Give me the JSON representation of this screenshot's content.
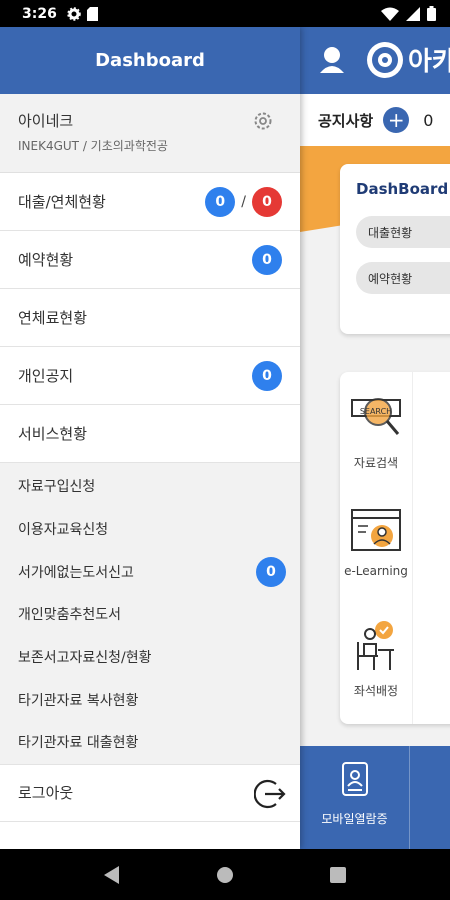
{
  "status_bar": {
    "time": "3:26"
  },
  "app": {
    "logo_text": "아카",
    "notice": {
      "title": "공지사항",
      "plus": "+",
      "count": "0"
    },
    "dashboard_card": {
      "title": "DashBoard",
      "pills": [
        "대출현황",
        "예약현황"
      ]
    },
    "menu": [
      {
        "label": "자료검색",
        "icon": "search-icon"
      },
      {
        "label": "e-Learning",
        "icon": "elearning-icon"
      },
      {
        "label": "좌석배정",
        "icon": "seat-icon"
      }
    ],
    "search_icon_text": "SEARCH",
    "bottom_tab": {
      "label": "모바일열람증",
      "icon": "mobile-card-icon"
    }
  },
  "drawer": {
    "title": "Dashboard",
    "profile": {
      "name": "아이네크",
      "sub": "INEK4GUT / 기초의과학전공"
    },
    "main_items": [
      {
        "label": "대출/연체현황"
      },
      {
        "label": "예약현황"
      },
      {
        "label": "연체료현황"
      },
      {
        "label": "개인공지"
      },
      {
        "label": "서비스현황"
      }
    ],
    "loan_badges": {
      "loan": "0",
      "slash": "/",
      "overdue": "0"
    },
    "reserve_badge": "0",
    "notice_badge": "0",
    "sub_items": [
      {
        "label": "자료구입신청"
      },
      {
        "label": "이용자교육신청"
      },
      {
        "label": "서가에없는도서신고"
      },
      {
        "label": "개인맞춤추천도서"
      },
      {
        "label": "보존서고자료신청/현황"
      },
      {
        "label": "타기관자료 복사현황"
      },
      {
        "label": "타기관자료 대출현황"
      }
    ],
    "missing_badge": "0",
    "logout": "로그아웃"
  },
  "colors": {
    "primary": "#3a67b1",
    "accent_orange": "#f3a540",
    "badge_blue": "#2f80ed",
    "badge_red": "#e53935"
  }
}
